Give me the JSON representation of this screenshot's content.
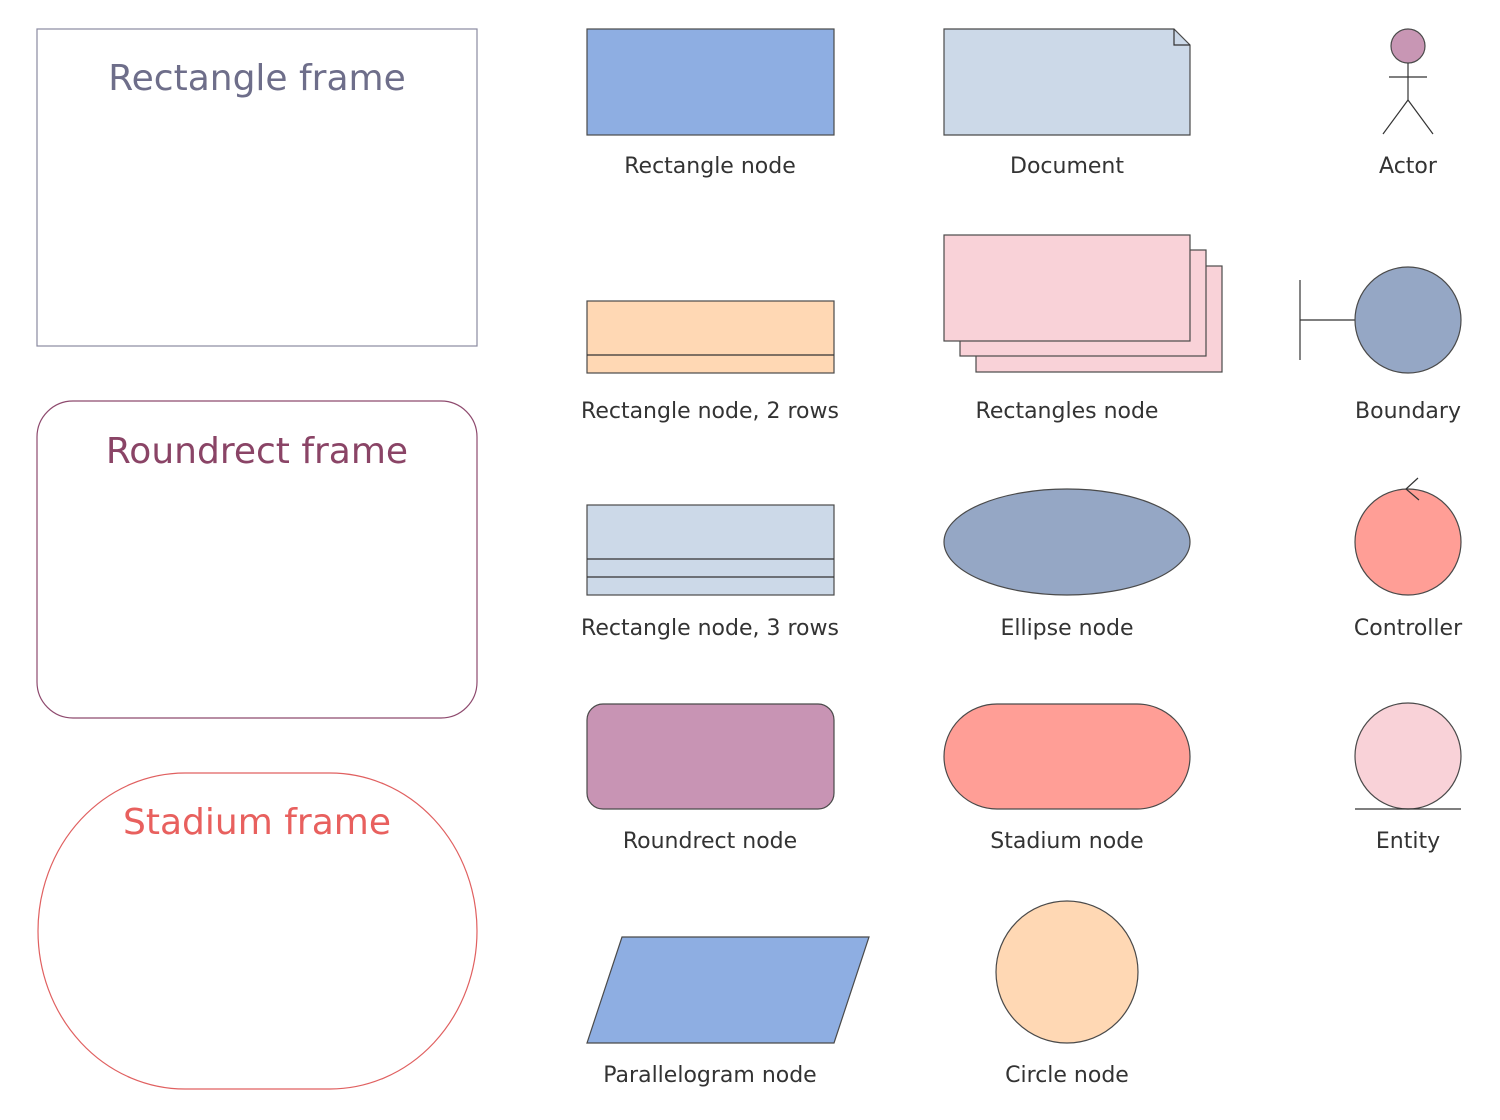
{
  "frames": [
    {
      "id": "rectangle-frame",
      "label": "Rectangle frame",
      "shape": "rectangle",
      "stroke": "#8a8aa0",
      "text_color": "#6e6e8a"
    },
    {
      "id": "roundrect-frame",
      "label": "Roundrect frame",
      "shape": "roundrect",
      "stroke": "#8e4a6e",
      "text_color": "#8a4466"
    },
    {
      "id": "stadium-frame",
      "label": "Stadium frame",
      "shape": "stadium",
      "stroke": "#e06060",
      "text_color": "#e8605e"
    }
  ],
  "nodes": {
    "rectangle": {
      "label": "Rectangle node",
      "fill": "#8eaee2"
    },
    "document": {
      "label": "Document",
      "fill": "#ccd9e8"
    },
    "actor": {
      "label": "Actor",
      "fill": "#c896b4"
    },
    "rectangle_2rows": {
      "label": "Rectangle node, 2 rows",
      "fill": "#ffd8b4"
    },
    "rectangles": {
      "label": "Rectangles node",
      "fill": "#f9d2d8"
    },
    "boundary": {
      "label": "Boundary",
      "fill": "#95a7c5"
    },
    "rectangle_3rows": {
      "label": "Rectangle node, 3 rows",
      "fill": "#ccd9e8"
    },
    "ellipse": {
      "label": "Ellipse node",
      "fill": "#95a7c5"
    },
    "controller": {
      "label": "Controller",
      "fill": "#ff9e96"
    },
    "roundrect": {
      "label": "Roundrect node",
      "fill": "#c894b4"
    },
    "stadium": {
      "label": "Stadium node",
      "fill": "#ff9e96"
    },
    "entity": {
      "label": "Entity",
      "fill": "#f9d2d8"
    },
    "parallelogram": {
      "label": "Parallelogram node",
      "fill": "#8eaee2"
    },
    "circle": {
      "label": "Circle node",
      "fill": "#ffd8b4"
    }
  }
}
